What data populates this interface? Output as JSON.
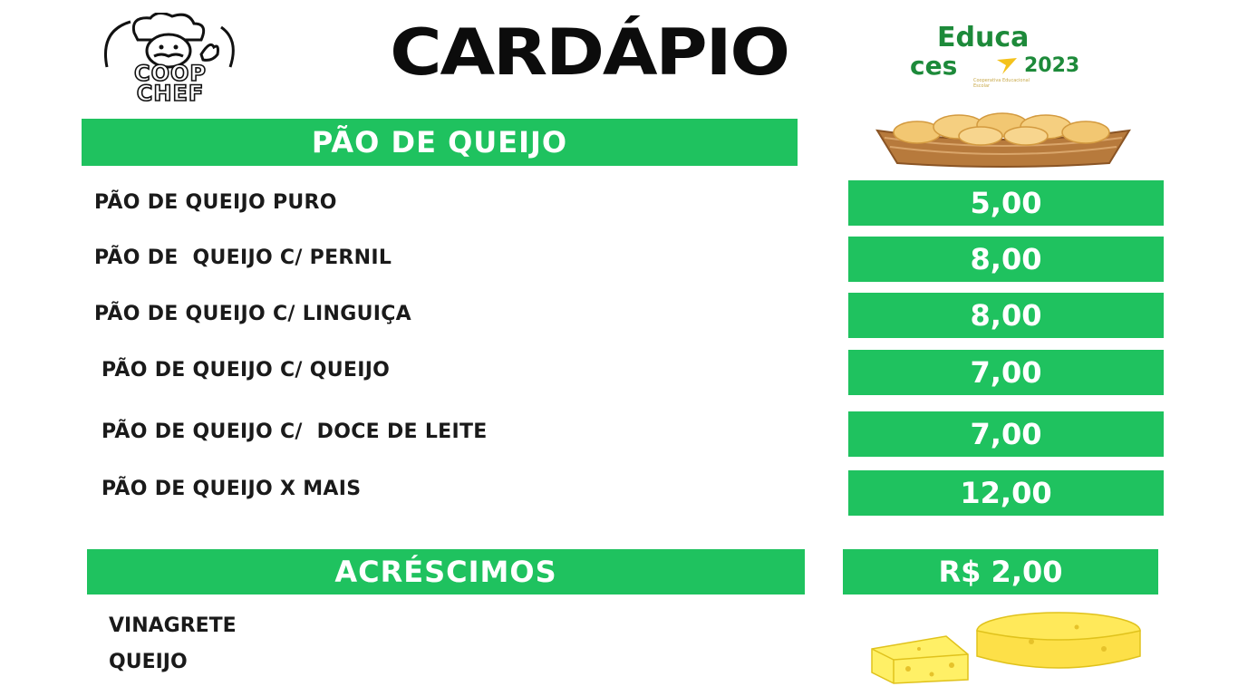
{
  "header": {
    "logo_left": {
      "line1": "COOP",
      "line2": "CHEF"
    },
    "title": "CARDÁPIO",
    "brand": {
      "word1": "Educa",
      "word2": "ces",
      "year": "2023",
      "tagline": "Cooperativa Educacional Escolar"
    }
  },
  "section": {
    "title": "PÃO DE  QUEIJO"
  },
  "items": [
    {
      "name": "PÃO DE QUEIJO PURO",
      "price": "5,00"
    },
    {
      "name": "PÃO DE  QUEIJO C/ PERNIL",
      "price": "8,00"
    },
    {
      "name": "PÃO DE QUEIJO C/ LINGUIÇA",
      "price": "8,00"
    },
    {
      "name": "PÃO DE QUEIJO C/ QUEIJO",
      "price": "7,00"
    },
    {
      "name": "PÃO DE QUEIJO C/  DOCE DE LEITE",
      "price": "7,00"
    },
    {
      "name": "PÃO DE QUEIJO X MAIS",
      "price": "12,00"
    }
  ],
  "addons": {
    "title": "ACRÉSCIMOS",
    "price": "R$ 2,00",
    "items": [
      "VINAGRETE",
      "QUEIJO"
    ]
  },
  "colors": {
    "green": "#1fc25f",
    "brand_green": "#1d8a3a",
    "text": "#1a1a1a"
  },
  "images": {
    "top": "pao-de-queijo-basket",
    "bottom": "cheese-wheel"
  }
}
